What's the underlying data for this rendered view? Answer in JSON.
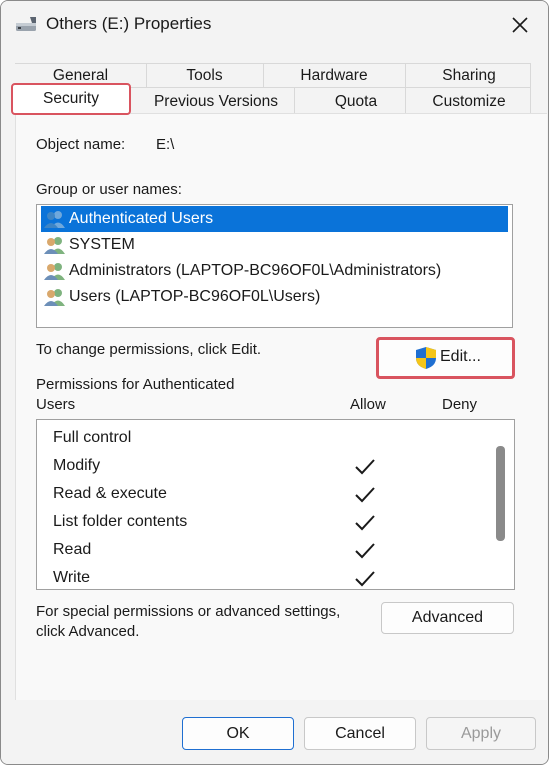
{
  "window": {
    "title": "Others (E:) Properties"
  },
  "tabs": {
    "row1": [
      "General",
      "Tools",
      "Hardware",
      "Sharing"
    ],
    "row2": [
      "Security",
      "Previous Versions",
      "Quota",
      "Customize"
    ],
    "active": "Security"
  },
  "security": {
    "object_name_label": "Object name:",
    "object_name_value": "E:\\",
    "group_label": "Group or user names:",
    "users": [
      {
        "name": "Authenticated Users",
        "selected": true
      },
      {
        "name": "SYSTEM",
        "selected": false
      },
      {
        "name": "Administrators (LAPTOP-BC96OF0L\\Administrators)",
        "selected": false
      },
      {
        "name": "Users (LAPTOP-BC96OF0L\\Users)",
        "selected": false
      }
    ],
    "change_text": "To change permissions, click Edit.",
    "edit_label": "Edit...",
    "permissions_label_line1": "Permissions for Authenticated",
    "permissions_label_line2": "Users",
    "allow_header": "Allow",
    "deny_header": "Deny",
    "permissions": [
      {
        "name": "Full control",
        "allow": false,
        "deny": false
      },
      {
        "name": "Modify",
        "allow": true,
        "deny": false
      },
      {
        "name": "Read & execute",
        "allow": true,
        "deny": false
      },
      {
        "name": "List folder contents",
        "allow": true,
        "deny": false
      },
      {
        "name": "Read",
        "allow": true,
        "deny": false
      },
      {
        "name": "Write",
        "allow": true,
        "deny": false
      }
    ],
    "special_text_line1": "For special permissions or advanced settings,",
    "special_text_line2": "click Advanced.",
    "advanced_label": "Advanced"
  },
  "footer": {
    "ok_label": "OK",
    "cancel_label": "Cancel",
    "apply_label": "Apply"
  },
  "colors": {
    "highlight": "#d9545f",
    "selection": "#0a73d9"
  }
}
